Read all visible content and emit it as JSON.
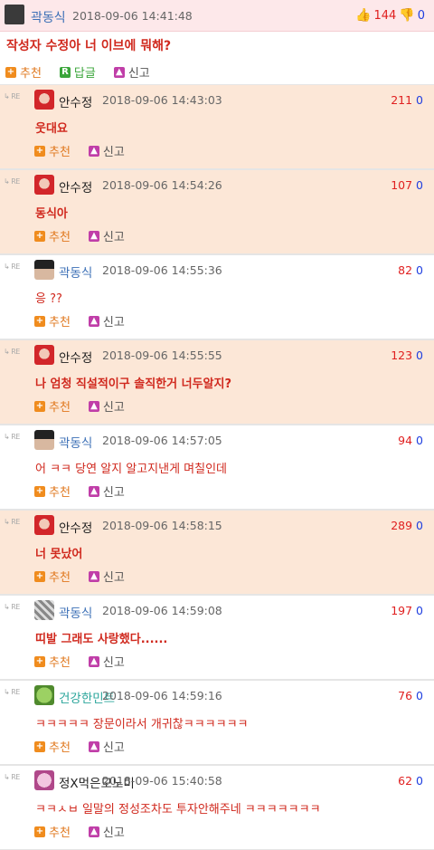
{
  "post": {
    "nickname": "곽동식",
    "date": "2018-09-06 14:41:48",
    "up_count": "144",
    "down_count": "0",
    "title": "작성자 수정아 너 이브에 뭐해?",
    "actions": {
      "recommend": "추천",
      "reply": "답글",
      "report": "신고"
    }
  },
  "comments": [
    {
      "nickname": "안수정",
      "date": "2018-09-06 14:43:03",
      "up": "211",
      "down": "0",
      "text": "웃대요",
      "highlight": true,
      "avatar": "red"
    },
    {
      "nickname": "안수정",
      "date": "2018-09-06 14:54:26",
      "up": "107",
      "down": "0",
      "text": "동식아",
      "highlight": true,
      "avatar": "red"
    },
    {
      "nickname": "곽동식",
      "date": "2018-09-06 14:55:36",
      "up": "82",
      "down": "0",
      "text": "응 ??",
      "highlight": false,
      "avatar": "dark"
    },
    {
      "nickname": "안수정",
      "date": "2018-09-06 14:55:55",
      "up": "123",
      "down": "0",
      "text": "나 엄청 직설적이구 솔직한거 너두알지?",
      "highlight": true,
      "avatar": "red"
    },
    {
      "nickname": "곽동식",
      "date": "2018-09-06 14:57:05",
      "up": "94",
      "down": "0",
      "text": "어 ㅋㅋ 당연 알지 알고지낸게 며칠인데",
      "highlight": false,
      "avatar": "dark"
    },
    {
      "nickname": "안수정",
      "date": "2018-09-06 14:58:15",
      "up": "289",
      "down": "0",
      "text": "너 못났어",
      "highlight": true,
      "avatar": "red"
    },
    {
      "nickname": "곽동식",
      "date": "2018-09-06 14:59:08",
      "up": "197",
      "down": "0",
      "text": "띠발 그래도 사랑했다......",
      "highlight": false,
      "avatar": "gray"
    },
    {
      "nickname": "건강한민트",
      "date": "2018-09-06 14:59:16",
      "up": "76",
      "down": "0",
      "text": "ㅋㅋㅋㅋㅋ 장문이라서 개귀찮ㅋㅋㅋㅋㅋㅋ",
      "highlight": false,
      "avatar": "green"
    },
    {
      "nickname": "정X먹은모노미",
      "date": "2018-09-06 15:40:58",
      "up": "62",
      "down": "0",
      "text": "ㅋㅋㅅㅂ 일말의 정성조차도 투자안해주네 ㅋㅋㅋㅋㅋㅋㅋ",
      "highlight": false,
      "avatar": "pink"
    }
  ],
  "comment_actions": {
    "recommend": "추천",
    "report": "신고"
  },
  "re_label": "RE",
  "colors": {
    "accent_red": "#e02020",
    "count_blue": "#1f3fe0",
    "highlight_bg": "#fce7d7",
    "post_bg": "#fde8ea"
  }
}
